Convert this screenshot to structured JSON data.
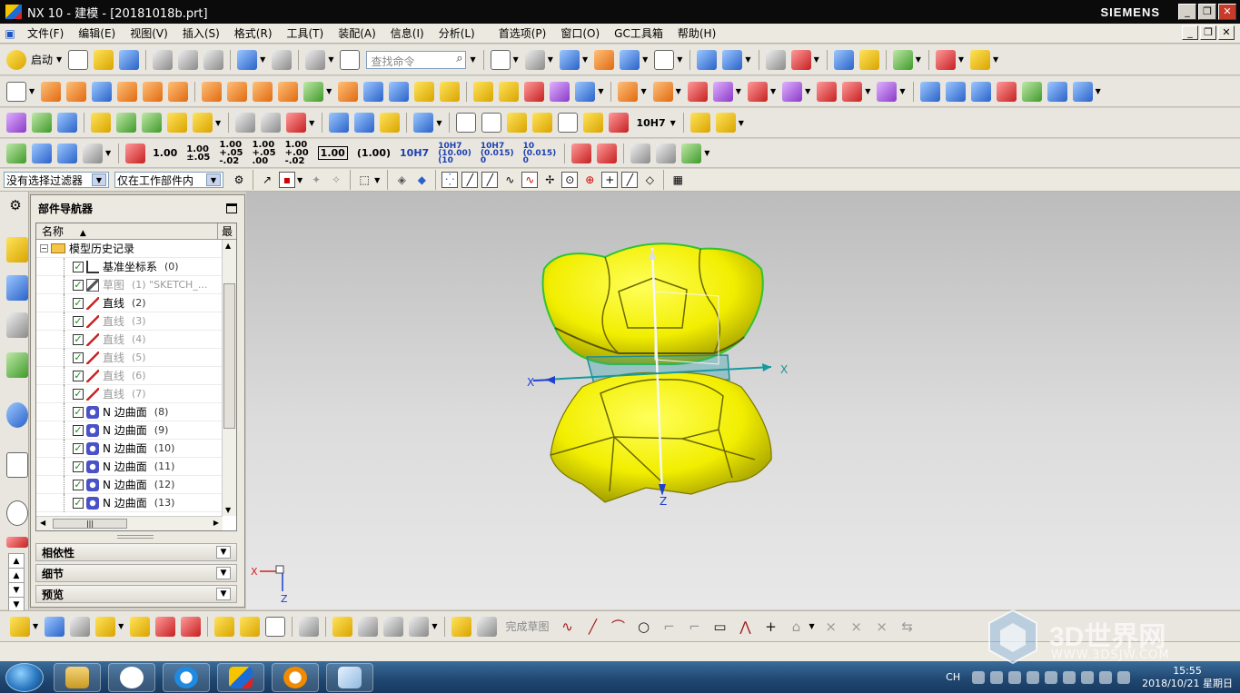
{
  "window": {
    "title": "NX 10 - 建模 - [20181018b.prt]",
    "brand": "SIEMENS"
  },
  "menu": [
    "文件(F)",
    "编辑(E)",
    "视图(V)",
    "插入(S)",
    "格式(R)",
    "工具(T)",
    "装配(A)",
    "信息(I)",
    "分析(L)",
    "首选项(P)",
    "窗口(O)",
    "GC工具箱",
    "帮助(H)"
  ],
  "toolbar": {
    "start_label": "启动",
    "search_placeholder": "查找命令"
  },
  "dimension_labels": [
    "1.00",
    "1.00\n±.05",
    "1.00\n+.05\n-.02",
    "1.00\n+.05\n.00",
    "1.00\n+.00\n-.02",
    "1.00",
    "(1.00)",
    "10H7",
    "10H7\n(10.00)\n(10",
    "10H7\n(0.015)\n0",
    "10\n(0.015)\n0"
  ],
  "selection": {
    "filter": "没有选择过滤器",
    "scope": "仅在工作部件内"
  },
  "navigator": {
    "title": "部件导航器",
    "col_name": "名称",
    "col_recent": "最",
    "root": "模型历史记录",
    "items": [
      {
        "label": "基准坐标系",
        "num": "(0)",
        "icon": "csys",
        "dim": false
      },
      {
        "label": "草图",
        "num": "(1) \"SKETCH_...",
        "icon": "sketch",
        "dim": true
      },
      {
        "label": "直线",
        "num": "(2)",
        "icon": "line",
        "dim": false
      },
      {
        "label": "直线",
        "num": "(3)",
        "icon": "line",
        "dim": true
      },
      {
        "label": "直线",
        "num": "(4)",
        "icon": "line",
        "dim": true
      },
      {
        "label": "直线",
        "num": "(5)",
        "icon": "line",
        "dim": true
      },
      {
        "label": "直线",
        "num": "(6)",
        "icon": "line",
        "dim": true
      },
      {
        "label": "直线",
        "num": "(7)",
        "icon": "line",
        "dim": true
      },
      {
        "label": "N 边曲面",
        "num": "(8)",
        "icon": "surface",
        "dim": false
      },
      {
        "label": "N 边曲面",
        "num": "(9)",
        "icon": "surface",
        "dim": false
      },
      {
        "label": "N 边曲面",
        "num": "(10)",
        "icon": "surface",
        "dim": false
      },
      {
        "label": "N 边曲面",
        "num": "(11)",
        "icon": "surface",
        "dim": false
      },
      {
        "label": "N 边曲面",
        "num": "(12)",
        "icon": "surface",
        "dim": false
      },
      {
        "label": "N 边曲面",
        "num": "(13)",
        "icon": "surface",
        "dim": false
      }
    ],
    "panels": [
      "相依性",
      "细节",
      "预览"
    ]
  },
  "viewport": {
    "axis_x": "X",
    "axis_z": "Z",
    "triad_x": "X",
    "triad_z": "Z"
  },
  "sketch_toolbar": {
    "finish_label": "完成草图"
  },
  "taskbar": {
    "lang": "CH",
    "time": "15:55",
    "date": "2018/10/21 星期日"
  },
  "watermark": {
    "text": "3D世界网",
    "url": "WWW.3DSJW.COM"
  }
}
